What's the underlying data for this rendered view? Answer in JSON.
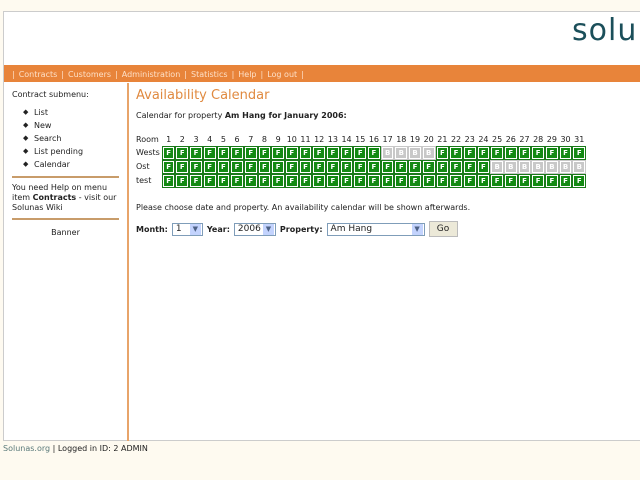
{
  "logo": "solunas",
  "nav": [
    "Contracts",
    "Customers",
    "Administration",
    "Statistics",
    "Help",
    "Log out"
  ],
  "sidebar": {
    "title": "Contract submenu:",
    "items": [
      "List",
      "New",
      "Search",
      "List pending",
      "Calendar"
    ],
    "help_pre": "You need Help on menu item ",
    "help_bold": "Contracts",
    "help_post": " - visit our Solunas Wiki",
    "banner": "Banner"
  },
  "main": {
    "title": "Availability Calendar",
    "intro_pre": "Calendar for property ",
    "intro_bold": "Am Hang for January 2006:",
    "room_label": "Room",
    "rooms": [
      {
        "name": "Wests",
        "days": "FFFFFFFFFFFFFFFFBBBBFFFFFFFFFFF"
      },
      {
        "name": "Ost",
        "days": "FFFFFFFFFFFFFFFFFFFFFFFFBBBBBBB"
      },
      {
        "name": "test",
        "days": "FFFFFFFFFFFFFFFFFFFFFFFFFFFFFFF"
      }
    ],
    "choose": "Please choose date and property. An availability calendar will be shown afterwards.",
    "month_label": "Month:",
    "month": "1",
    "year_label": "Year:",
    "year": "2006",
    "property_label": "Property:",
    "property": "Am Hang",
    "go": "Go"
  },
  "footer": {
    "org": "Solunas.org",
    "status": " | Logged in ID: 2 ADMIN"
  },
  "colors": {
    "free": "#138a13",
    "booked": "#c8c8c8",
    "accent": "#e8843a"
  }
}
